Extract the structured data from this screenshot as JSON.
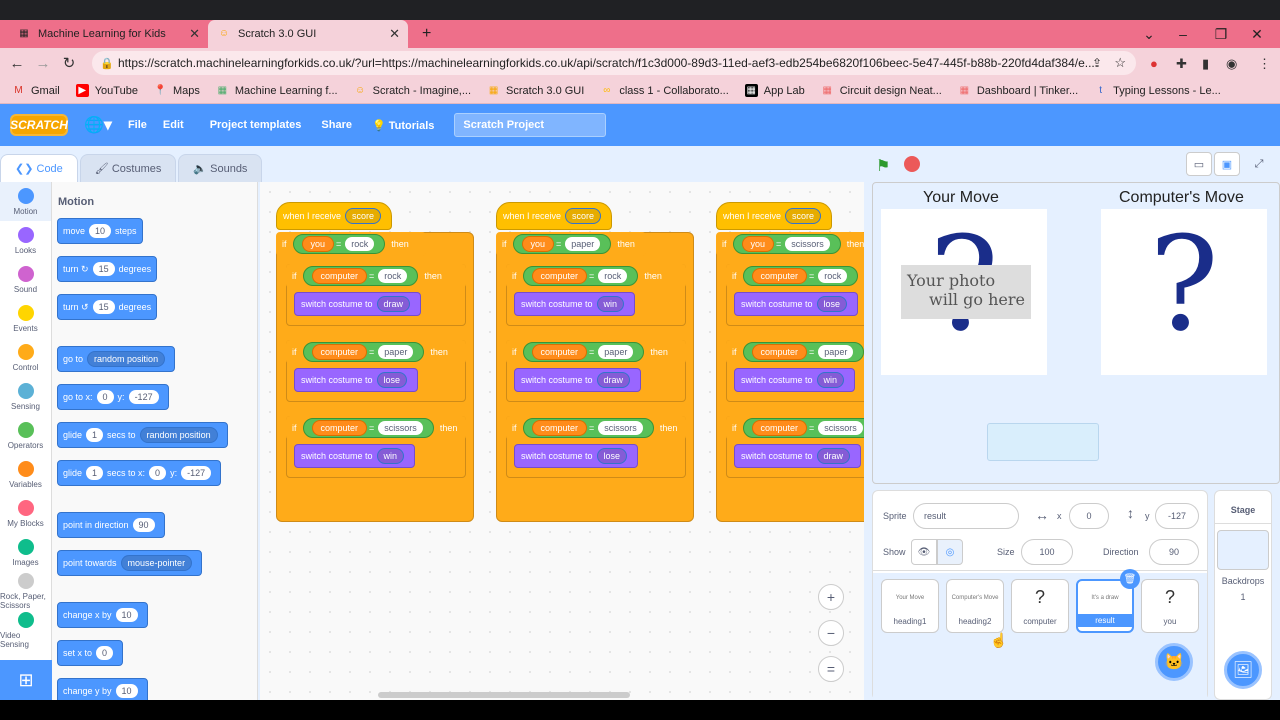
{
  "browser": {
    "tabs": [
      {
        "title": "Machine Learning for Kids"
      },
      {
        "title": "Scratch 3.0 GUI"
      }
    ],
    "url": "https://scratch.machinelearningforkids.co.uk/?url=https://machinelearningforkids.co.uk/api/scratch/f1c3d000-89d3-11ed-aef3-edb254be6820f106beec-5e47-445f-b88b-220fd4daf384/e...",
    "bookmarks": [
      "Gmail",
      "YouTube",
      "Maps",
      "Machine Learning f...",
      "Scratch - Imagine,...",
      "Scratch 3.0 GUI",
      "class 1 - Collaborato...",
      "App Lab",
      "Circuit design Neat...",
      "Dashboard | Tinker...",
      "Typing Lessons - Le..."
    ]
  },
  "menu": {
    "logo": "SCRATCH",
    "items": [
      "File",
      "Edit",
      "Project templates",
      "Share"
    ],
    "tutorials": "Tutorials",
    "project_title": "Scratch Project"
  },
  "editor_tabs": [
    "Code",
    "Costumes",
    "Sounds"
  ],
  "categories": [
    {
      "label": "Motion",
      "color": "#4c97ff"
    },
    {
      "label": "Looks",
      "color": "#9966ff"
    },
    {
      "label": "Sound",
      "color": "#cf63cf"
    },
    {
      "label": "Events",
      "color": "#ffd500"
    },
    {
      "label": "Control",
      "color": "#ffab19"
    },
    {
      "label": "Sensing",
      "color": "#5cb1d6"
    },
    {
      "label": "Operators",
      "color": "#59c059"
    },
    {
      "label": "Variables",
      "color": "#ff8c1a"
    },
    {
      "label": "My Blocks",
      "color": "#ff6680"
    },
    {
      "label": "Images",
      "color": "#0fbd8c"
    },
    {
      "label": "Rock, Paper, Scissors",
      "color": "#cccccc"
    },
    {
      "label": "Video Sensing",
      "color": "#0fbd8c"
    }
  ],
  "palette": {
    "title": "Motion",
    "move": {
      "a": "move",
      "v": "10",
      "b": "steps"
    },
    "turn_cw": {
      "a": "turn",
      "v": "15",
      "b": "degrees"
    },
    "turn_ccw": {
      "a": "turn",
      "v": "15",
      "b": "degrees"
    },
    "goto": {
      "a": "go to",
      "d": "random position"
    },
    "gotoxy": {
      "a": "go to x:",
      "x": "0",
      "b": "y:",
      "y": "-127"
    },
    "glide": {
      "a": "glide",
      "v": "1",
      "b": "secs to",
      "d": "random position"
    },
    "glidexy": {
      "a": "glide",
      "v": "1",
      "b": "secs to x:",
      "x": "0",
      "c": "y:",
      "y": "-127"
    },
    "point": {
      "a": "point in direction",
      "v": "90"
    },
    "towards": {
      "a": "point towards",
      "d": "mouse-pointer"
    },
    "changex": {
      "a": "change x by",
      "v": "10"
    },
    "setx": {
      "a": "set x to",
      "v": "0"
    },
    "changey": {
      "a": "change y by",
      "v": "10"
    }
  },
  "scripts": [
    {
      "hat": "when I receive",
      "msg": "score",
      "var": "you",
      "val": "rock",
      "rows": [
        {
          "val": "rock",
          "costume": "draw"
        },
        {
          "val": "paper",
          "costume": "lose"
        },
        {
          "val": "scissors",
          "costume": "win"
        }
      ]
    },
    {
      "hat": "when I receive",
      "msg": "score",
      "var": "you",
      "val": "paper",
      "rows": [
        {
          "val": "rock",
          "costume": "win"
        },
        {
          "val": "paper",
          "costume": "draw"
        },
        {
          "val": "scissors",
          "costume": "lose"
        }
      ]
    },
    {
      "hat": "when I receive",
      "msg": "score",
      "var": "you",
      "val": "scissors",
      "rows": [
        {
          "val": "rock",
          "costume": "lose"
        },
        {
          "val": "paper",
          "costume": "win"
        },
        {
          "val": "scissors",
          "costume": "draw"
        }
      ]
    }
  ],
  "script_words": {
    "if": "if",
    "then": "then",
    "eq": "=",
    "computer": "computer",
    "switch": "switch costume to"
  },
  "stage": {
    "your_move": "Your Move",
    "computer_move": "Computer's Move",
    "photo_line1": "Your photo",
    "photo_line2": "will go here",
    "qmark": "?"
  },
  "sprite_info": {
    "sprite_label": "Sprite",
    "sprite_name": "result",
    "x_label": "x",
    "x": "0",
    "y_label": "y",
    "y": "-127",
    "show_label": "Show",
    "size_label": "Size",
    "size": "100",
    "direction_label": "Direction",
    "direction": "90"
  },
  "sprites": [
    {
      "name": "heading1",
      "thumb": "Your Move"
    },
    {
      "name": "heading2",
      "thumb": "Computer's Move"
    },
    {
      "name": "computer",
      "thumb": "?"
    },
    {
      "name": "result",
      "thumb": "It's a draw"
    },
    {
      "name": "you",
      "thumb": "?"
    }
  ],
  "stage_panel": {
    "title": "Stage",
    "backdrops_label": "Backdrops",
    "backdrops": "1"
  }
}
